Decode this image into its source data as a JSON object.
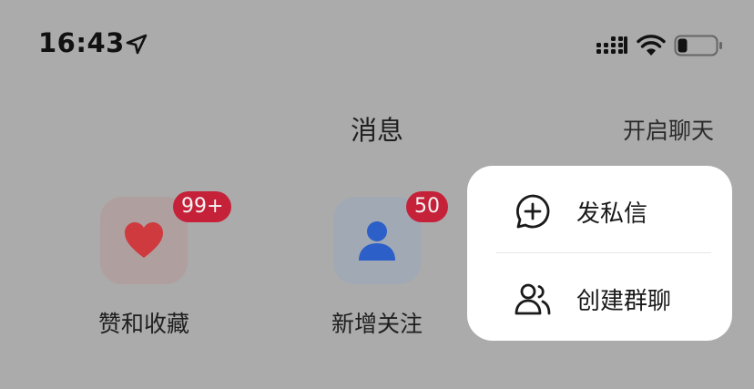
{
  "status_bar": {
    "time": "16:43",
    "icons": [
      "location-arrow-icon",
      "cellular-signal-icon",
      "wifi-icon",
      "battery-icon"
    ],
    "battery_level": 0.25
  },
  "nav": {
    "title": "消息",
    "action": "开启聊天"
  },
  "shortcuts": [
    {
      "label": "赞和收藏",
      "badge": "99+",
      "icon": "heart-icon",
      "icon_color": "#cf3a3e"
    },
    {
      "label": "新增关注",
      "badge": "50",
      "icon": "person-icon",
      "icon_color": "#2c5fc8"
    }
  ],
  "menu": {
    "items": [
      {
        "label": "发私信",
        "icon": "chat-plus-icon"
      },
      {
        "label": "创建群聊",
        "icon": "group-users-icon"
      }
    ]
  },
  "colors": {
    "overlay_background": "#ababab",
    "badge": "#c5223a",
    "popover": "#ffffff"
  }
}
